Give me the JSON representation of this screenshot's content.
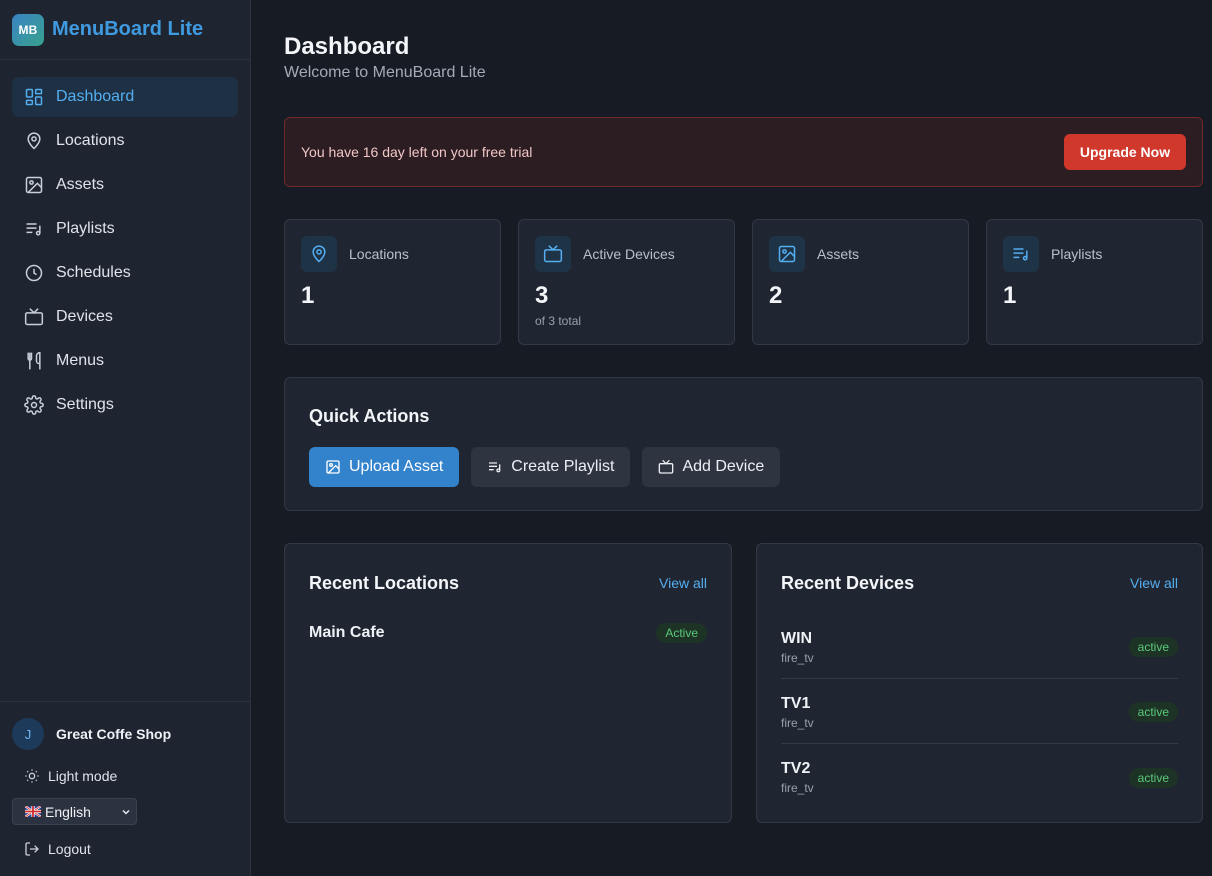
{
  "brand": {
    "logo_text": "MB",
    "name": "MenuBoard Lite"
  },
  "sidebar": {
    "items": [
      {
        "label": "Dashboard",
        "icon": "dashboard-icon",
        "active": true
      },
      {
        "label": "Locations",
        "icon": "map-pin-icon"
      },
      {
        "label": "Assets",
        "icon": "image-icon"
      },
      {
        "label": "Playlists",
        "icon": "playlist-icon"
      },
      {
        "label": "Schedules",
        "icon": "clock-icon"
      },
      {
        "label": "Devices",
        "icon": "tv-icon"
      },
      {
        "label": "Menus",
        "icon": "utensils-icon"
      },
      {
        "label": "Settings",
        "icon": "gear-icon"
      }
    ],
    "account": {
      "initial": "J",
      "name": "Great Coffe Shop"
    },
    "theme_toggle": "Light mode",
    "language": {
      "selected": "English",
      "flag": "uk-flag-icon"
    },
    "logout": "Logout"
  },
  "header": {
    "title": "Dashboard",
    "subtitle": "Welcome to MenuBoard Lite"
  },
  "trial_banner": {
    "message": "You have 16 day left on your free trial",
    "button": "Upgrade Now"
  },
  "stats": [
    {
      "label": "Locations",
      "value": "1",
      "sub": ""
    },
    {
      "label": "Active Devices",
      "value": "3",
      "sub": "of 3 total"
    },
    {
      "label": "Assets",
      "value": "2",
      "sub": ""
    },
    {
      "label": "Playlists",
      "value": "1",
      "sub": ""
    }
  ],
  "quick_actions": {
    "title": "Quick Actions",
    "buttons": [
      {
        "label": "Upload Asset"
      },
      {
        "label": "Create Playlist"
      },
      {
        "label": "Add Device"
      }
    ]
  },
  "recent_locations": {
    "title": "Recent Locations",
    "view_all": "View all",
    "items": [
      {
        "name": "Main Cafe",
        "status": "Active"
      }
    ]
  },
  "recent_devices": {
    "title": "Recent Devices",
    "view_all": "View all",
    "items": [
      {
        "name": "WIN",
        "type": "fire_tv",
        "status": "active"
      },
      {
        "name": "TV1",
        "type": "fire_tv",
        "status": "active"
      },
      {
        "name": "TV2",
        "type": "fire_tv",
        "status": "active"
      }
    ]
  },
  "colors": {
    "accent": "#3383cc",
    "danger": "#d0382b",
    "success": "#5cc97a",
    "background": "#171b24",
    "sidebar": "#1f2530"
  }
}
